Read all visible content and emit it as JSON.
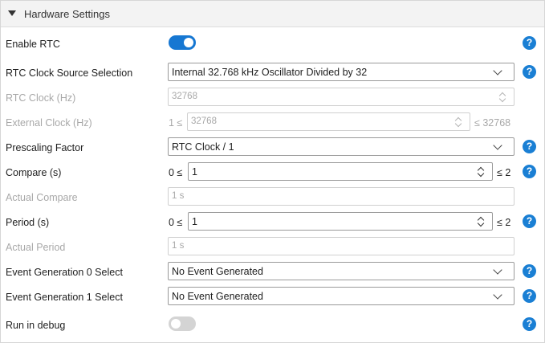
{
  "panel": {
    "title": "Hardware Settings"
  },
  "help_glyph": "?",
  "rows": {
    "enable_rtc": {
      "label": "Enable RTC",
      "enabled": true
    },
    "clock_source": {
      "label": "RTC Clock Source Selection",
      "value": "Internal 32.768 kHz Oscillator Divided by 32"
    },
    "rtc_clock": {
      "label": "RTC Clock (Hz)",
      "value": "32768"
    },
    "external_clock": {
      "label": "External Clock (Hz)",
      "min_label": "1 ≤",
      "value": "32768",
      "max_label": "≤ 32768"
    },
    "prescaling": {
      "label": "Prescaling Factor",
      "value": "RTC Clock / 1"
    },
    "compare": {
      "label": "Compare (s)",
      "min_label": "0 ≤",
      "value": "1",
      "max_label": "≤ 2"
    },
    "actual_compare": {
      "label": "Actual Compare",
      "value": "1 s"
    },
    "period": {
      "label": "Period (s)",
      "min_label": "0 ≤",
      "value": "1",
      "max_label": "≤ 2"
    },
    "actual_period": {
      "label": "Actual Period",
      "value": "1 s"
    },
    "event_gen0": {
      "label": "Event Generation 0 Select",
      "value": "No Event Generated"
    },
    "event_gen1": {
      "label": "Event Generation 1 Select",
      "value": "No Event Generated"
    },
    "run_in_debug": {
      "label": "Run in debug",
      "enabled": false
    }
  },
  "colors": {
    "accent": "#1677d2",
    "help": "#1a7fd4",
    "toggle_off": "#d4d4d4"
  }
}
